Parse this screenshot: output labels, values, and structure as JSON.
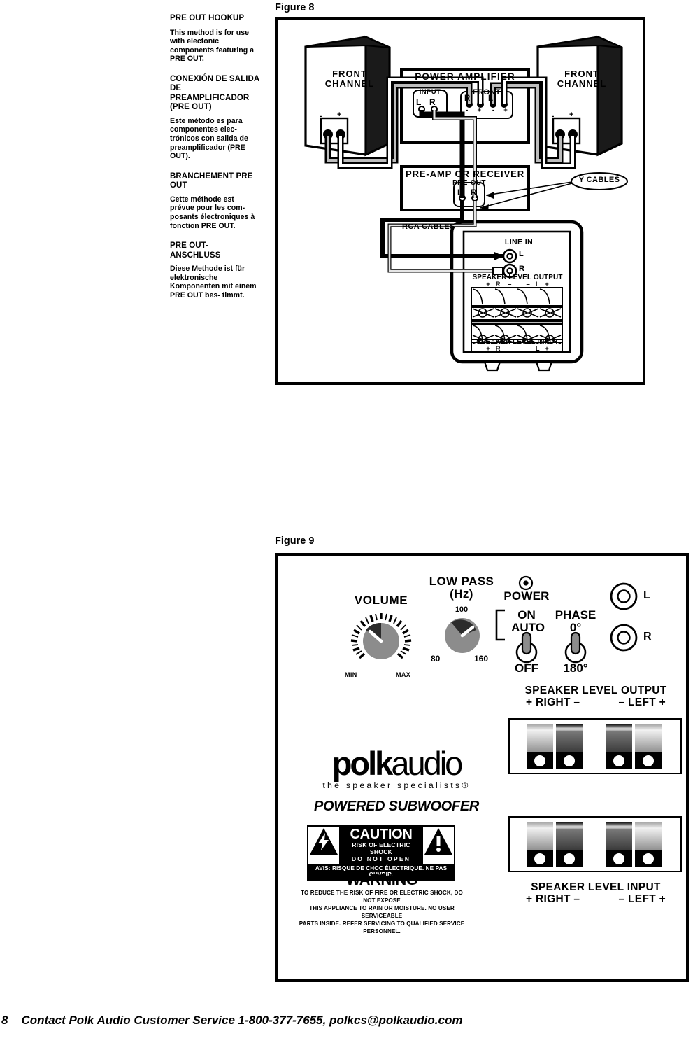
{
  "sidebar": {
    "sections": [
      {
        "heading": "PRE OUT HOOKUP",
        "body": "This method is for\nuse with electonic\ncomponents featuring\na PRE OUT."
      },
      {
        "heading": "CONEXIÓN DE\nSALIDA DE\nPREAMPLIFICADOR\n(PRE OUT)",
        "body": "Este método es para\ncomponentes elec-\ntrónicos con salida de\npreamplificador\n(PRE OUT)."
      },
      {
        "heading": "BRANCHEMENT\nPRE OUT",
        "body": "Cette méthode est\nprévue pour les com-\nposants électroniques\nà fonction PRE OUT."
      },
      {
        "heading": "PRE OUT-\nANSCHLUSS",
        "body": "Diese Methode ist für\nelektronische\nKomponenten mit\neinem PRE OUT bes-\ntimmt."
      }
    ]
  },
  "figure8": {
    "caption": "Figure 8",
    "speaker_left_label": "FRONT\nCHANNEL",
    "speaker_right_label": "FRONT\nCHANNEL",
    "speaker_terminal_minus": "-",
    "speaker_terminal_plus": "+",
    "amp_title": "POWER AMPLIFIER",
    "amp_input_label": "INPUT",
    "amp_input_l": "L",
    "amp_input_r": "R",
    "amp_front_label": "FRONT",
    "amp_front_r": "R",
    "amp_front_l": "L",
    "amp_polarity": "-     +      -     +",
    "receiver_title": "PRE-AMP OR RECEIVER",
    "preout_label": "PRE-OUT",
    "preout_l": "L",
    "preout_r": "R",
    "y_cables_label": "Y CABLES",
    "rca_cables_label": "RCA CABLES",
    "sub_line_in": "LINE IN",
    "sub_line_in_l": "L",
    "sub_line_in_r": "R",
    "sub_spk_output": "SPEAKER LEVEL OUTPUT",
    "sub_spk_output_marks": "+   R    –        –   L   +",
    "sub_spk_input": "SPEAKER LEVEL INPUT",
    "sub_spk_input_marks": "+   R    –        –   L   +"
  },
  "figure9": {
    "caption": "Figure 9",
    "volume_label": "VOLUME",
    "volume_min": "MIN",
    "volume_max": "MAX",
    "lowpass_label": "LOW PASS\n(Hz)",
    "lowpass_top": "100",
    "lowpass_left": "80",
    "lowpass_right": "160",
    "power_label": "POWER",
    "switch_on": "ON",
    "switch_auto": "AUTO",
    "switch_off": "OFF",
    "phase_label": "PHASE",
    "phase_0": "0°",
    "phase_180": "180°",
    "jack_l": "L",
    "jack_r": "R",
    "spk_output_title": "SPEAKER LEVEL OUTPUT",
    "spk_output_marks": "+ RIGHT –            – LEFT +",
    "spk_input_title": "SPEAKER LEVEL INPUT",
    "spk_input_marks": "+ RIGHT –            – LEFT +",
    "brand_bold": "polk",
    "brand_light": "audio",
    "brand_tagline": "the speaker specialists®",
    "product_label": "POWERED SUBWOOFER",
    "caution_title": "CAUTION",
    "caution_sub1": "RISK OF ELECTRIC SHOCK",
    "caution_sub2": "DO NOT OPEN",
    "caution_fr": "AVIS: RISQUE DE CHOC ÉLECTRIQUE. NE PAS OUVRIR.",
    "warning_title": "WARNING",
    "warning_body_l1": "TO REDUCE THE RISK OF FIRE OR ELECTRIC SHOCK, DO NOT EXPOSE",
    "warning_body_l2": "THIS APPLIANCE TO RAIN OR MOISTURE. NO USER SERVICEABLE",
    "warning_body_l3": "PARTS INSIDE. REFER SERVICING TO QUALIFIED SERVICE PERSONNEL."
  },
  "footer": {
    "page_number": "8",
    "text": "Contact Polk Audio Customer Service 1-800-377-7655, polkcs@polkaudio.com"
  },
  "colors": {
    "ink": "#000000",
    "knob_gray": "#8c8c8c",
    "knob_dark": "#2b2b2b",
    "paper": "#ffffff"
  }
}
